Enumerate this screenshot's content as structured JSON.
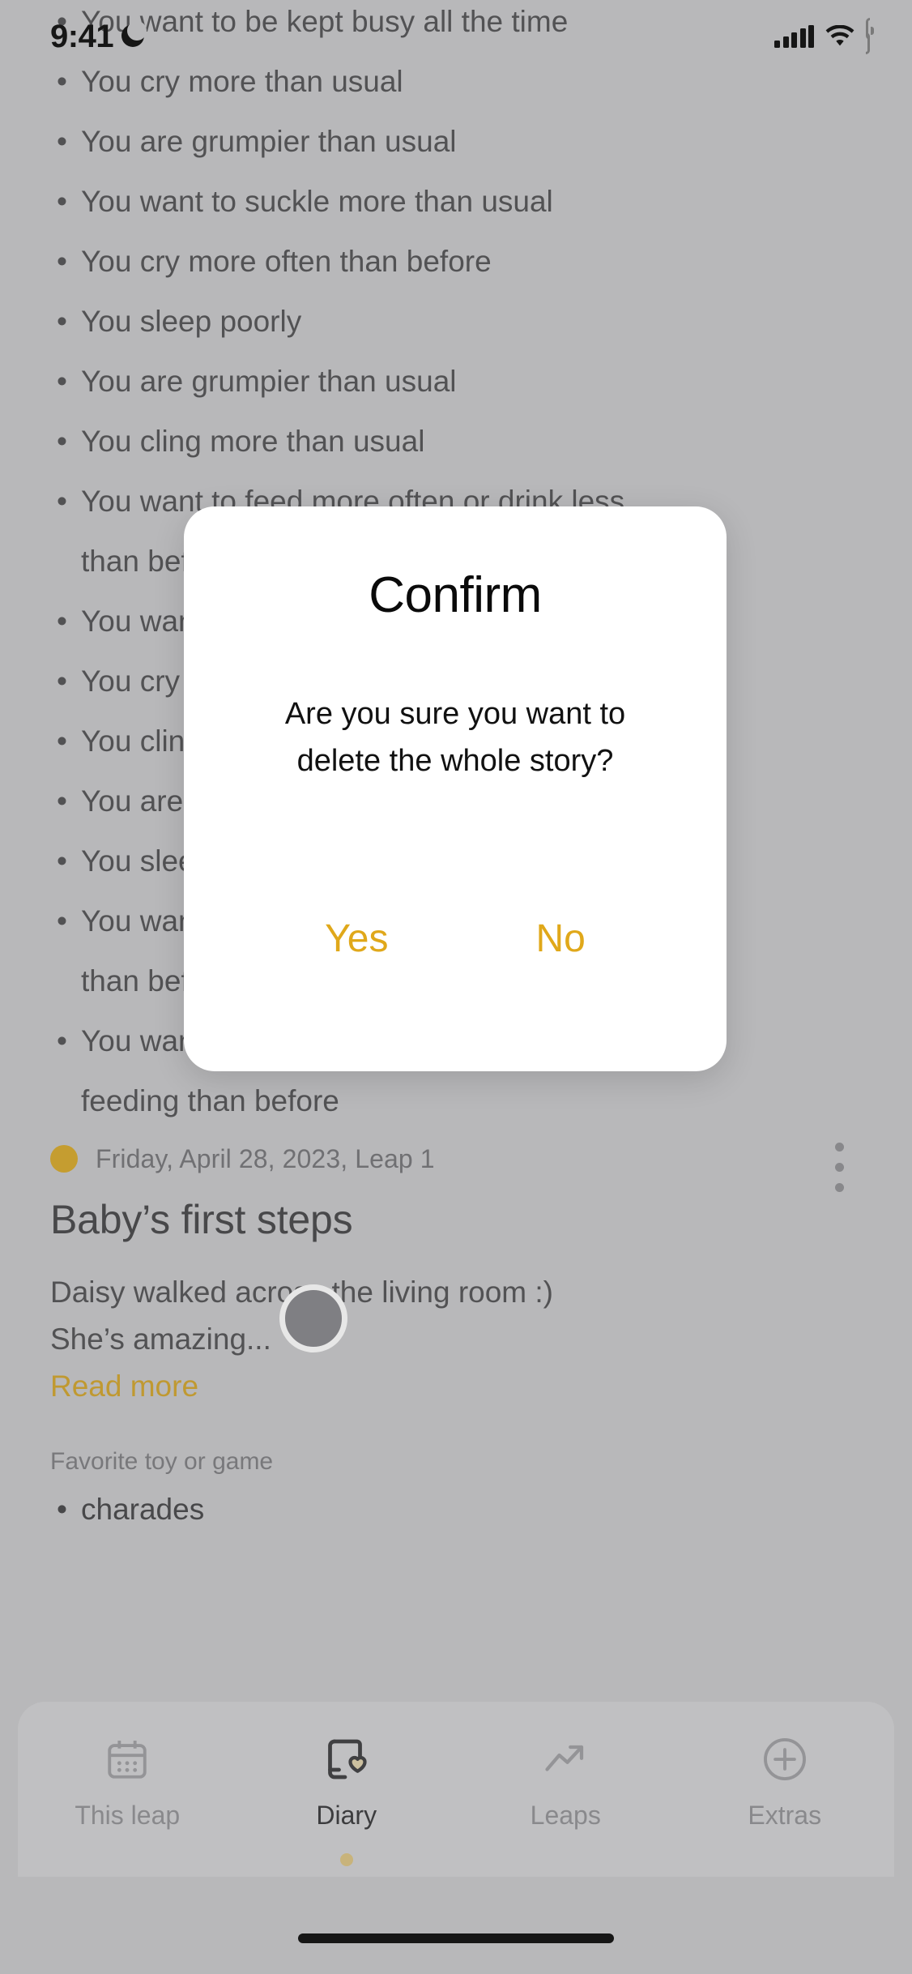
{
  "statusbar": {
    "time": "9:41",
    "moon_icon": "crescent-moon-icon",
    "signal_icon": "cellular-signal-icon",
    "wifi_icon": "wifi-icon",
    "battery_icon": "battery-full-icon"
  },
  "symptoms": {
    "items": [
      "You want to be kept busy all the time",
      "You cry more than usual",
      "You are grumpier than usual",
      "You want to suckle more than usual",
      "You cry more often than before",
      "You sleep poorly",
      "You are grumpier than usual",
      "You cling more than usual",
      "You want to feed more often or drink less\nthan before",
      "You want to be kept busy all the time",
      "You cry more than usual",
      "You cling more than usual",
      "You are grumpier than usual",
      "You sleep poorly",
      "You want to feed more often or drink less\nthan before",
      "You want to suckle more often during\nfeeding than before"
    ]
  },
  "entry": {
    "date": "Friday, April 28, 2023, Leap 1",
    "title": "Baby’s first steps",
    "body": "Daisy walked across the living room :)\nShe’s amazing...",
    "read_more": "Read more",
    "section_label": "Favorite toy or game",
    "favorites": [
      "charades"
    ],
    "accent_color": "#d6a520",
    "link_color": "#d0a022",
    "menu_icon": "kebab-menu-icon",
    "avatar_icon": "photo-avatar"
  },
  "dialog": {
    "title": "Confirm",
    "message": "Are you sure you want to\ndelete the whole story?",
    "confirm_label": "Yes",
    "cancel_label": "No",
    "button_color": "#e0a81a"
  },
  "tabbar": {
    "items": [
      {
        "label": "This leap",
        "icon": "calendar-icon",
        "active": false
      },
      {
        "label": "Diary",
        "icon": "book-heart-icon",
        "active": true
      },
      {
        "label": "Leaps",
        "icon": "trending-up-icon",
        "active": false
      },
      {
        "label": "Extras",
        "icon": "plus-circle-icon",
        "active": false
      }
    ],
    "indicator_color": "#d9c07c"
  }
}
